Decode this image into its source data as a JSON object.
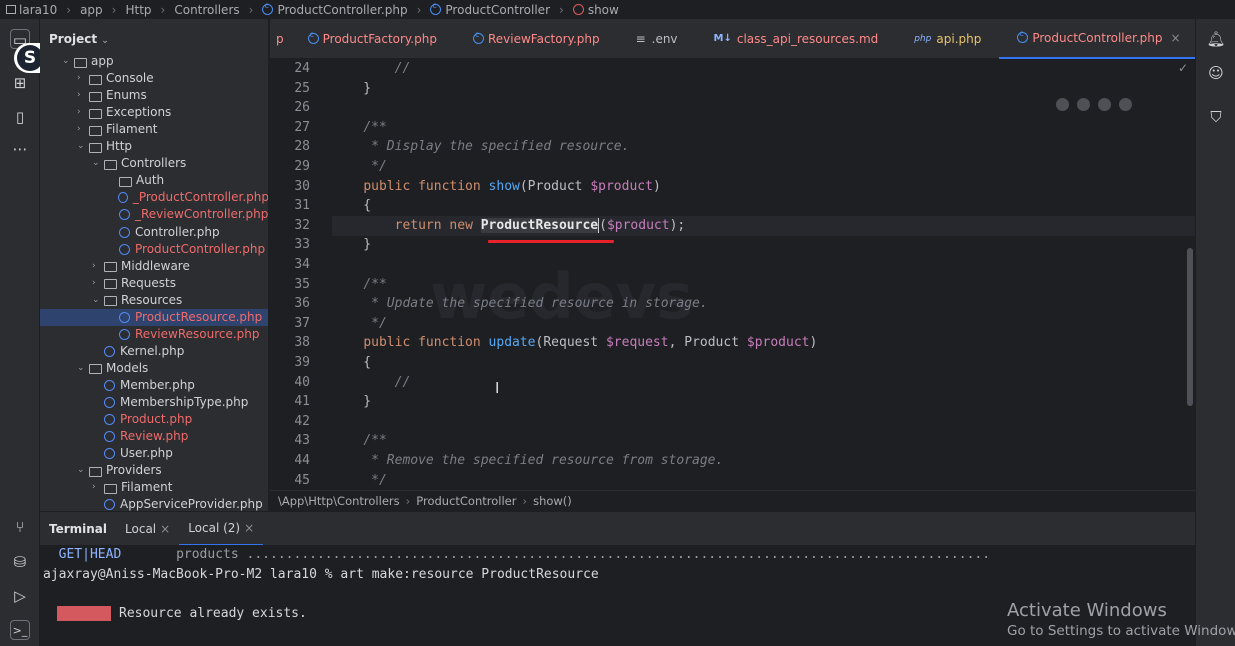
{
  "breadcrumb": {
    "items": [
      "lara10",
      "app",
      "Http",
      "Controllers",
      "ProductController.php",
      "ProductController",
      "show"
    ]
  },
  "project_panel": {
    "title": "Project",
    "rows": [
      {
        "label": "app",
        "type": "folder-open",
        "color": "white"
      },
      {
        "label": "Console",
        "type": "folder",
        "color": "white"
      },
      {
        "label": "Enums",
        "type": "folder",
        "color": "white"
      },
      {
        "label": "Exceptions",
        "type": "folder",
        "color": "white"
      },
      {
        "label": "Filament",
        "type": "folder",
        "color": "white"
      },
      {
        "label": "Http",
        "type": "folder-open",
        "color": "white"
      },
      {
        "label": "Controllers",
        "type": "folder-open",
        "color": "white"
      },
      {
        "label": "Auth",
        "type": "folder-leaf",
        "color": "white"
      },
      {
        "label": "_ProductController.php",
        "type": "php",
        "color": "red"
      },
      {
        "label": "_ReviewController.php",
        "type": "php",
        "color": "red"
      },
      {
        "label": "Controller.php",
        "type": "php",
        "color": "white"
      },
      {
        "label": "ProductController.php",
        "type": "php",
        "color": "red"
      },
      {
        "label": "Middleware",
        "type": "folder",
        "color": "white"
      },
      {
        "label": "Requests",
        "type": "folder",
        "color": "white"
      },
      {
        "label": "Resources",
        "type": "folder-open",
        "color": "white"
      },
      {
        "label": "ProductResource.php",
        "type": "php",
        "color": "red",
        "selected": true
      },
      {
        "label": "ReviewResource.php",
        "type": "php",
        "color": "red"
      },
      {
        "label": "Kernel.php",
        "type": "php",
        "color": "white"
      },
      {
        "label": "Models",
        "type": "folder-open",
        "color": "white"
      },
      {
        "label": "Member.php",
        "type": "php",
        "color": "white"
      },
      {
        "label": "MembershipType.php",
        "type": "php",
        "color": "white"
      },
      {
        "label": "Product.php",
        "type": "php",
        "color": "red"
      },
      {
        "label": "Review.php",
        "type": "php",
        "color": "red"
      },
      {
        "label": "User.php",
        "type": "php",
        "color": "white"
      },
      {
        "label": "Providers",
        "type": "folder-open",
        "color": "white"
      },
      {
        "label": "Filament",
        "type": "folder",
        "color": "white"
      },
      {
        "label": "AppServiceProvider.php",
        "type": "php",
        "color": "white"
      }
    ]
  },
  "tabs": [
    {
      "label": "p",
      "icon": "none",
      "color": "r"
    },
    {
      "label": "ProductFactory.php",
      "icon": "php",
      "color": "r"
    },
    {
      "label": "ReviewFactory.php",
      "icon": "php",
      "color": "r"
    },
    {
      "label": ".env",
      "icon": "env",
      "color": "g"
    },
    {
      "label": "class_api_resources.md",
      "icon": "md",
      "color": "r"
    },
    {
      "label": "api.php",
      "icon": "php-file",
      "color": "y"
    },
    {
      "label": "ProductController.php",
      "icon": "php",
      "color": "r",
      "active": true
    }
  ],
  "editor": {
    "lines": [
      {
        "n": "24",
        "html_parts": [
          [
            "tx",
            "        "
          ],
          [
            "cm",
            "//"
          ]
        ]
      },
      {
        "n": "25",
        "html_parts": [
          [
            "tx",
            "    }"
          ]
        ]
      },
      {
        "n": "26",
        "html_parts": []
      },
      {
        "n": "27",
        "html_parts": [
          [
            "tx",
            "    "
          ],
          [
            "cm",
            "/**"
          ]
        ]
      },
      {
        "n": "28",
        "html_parts": [
          [
            "tx",
            "     "
          ],
          [
            "cm",
            "* Display the specified resource."
          ]
        ]
      },
      {
        "n": "29",
        "html_parts": [
          [
            "tx",
            "     "
          ],
          [
            "cm",
            "*/"
          ]
        ]
      },
      {
        "n": "30",
        "html_parts": [
          [
            "tx",
            "    "
          ],
          [
            "kw",
            "public function "
          ],
          [
            "fn",
            "show"
          ],
          [
            "tx",
            "(Product "
          ],
          [
            "var",
            "$product"
          ],
          [
            "tx",
            ")"
          ]
        ]
      },
      {
        "n": "31",
        "html_parts": [
          [
            "tx",
            "    {"
          ]
        ]
      },
      {
        "n": "32",
        "current": true,
        "html_parts": [
          [
            "tx",
            "        "
          ],
          [
            "kw",
            "return new "
          ],
          [
            "hl",
            "ProductResource"
          ],
          [
            "tx",
            "("
          ],
          [
            "var",
            "$product"
          ],
          [
            "tx",
            ");"
          ]
        ]
      },
      {
        "n": "33",
        "html_parts": [
          [
            "tx",
            "    }"
          ]
        ]
      },
      {
        "n": "34",
        "html_parts": []
      },
      {
        "n": "35",
        "html_parts": [
          [
            "tx",
            "    "
          ],
          [
            "cm",
            "/**"
          ]
        ]
      },
      {
        "n": "36",
        "html_parts": [
          [
            "tx",
            "     "
          ],
          [
            "cm",
            "* Update the specified resource in storage."
          ]
        ]
      },
      {
        "n": "37",
        "html_parts": [
          [
            "tx",
            "     "
          ],
          [
            "cm",
            "*/"
          ]
        ]
      },
      {
        "n": "38",
        "html_parts": [
          [
            "tx",
            "    "
          ],
          [
            "kw",
            "public function "
          ],
          [
            "fn",
            "update"
          ],
          [
            "tx",
            "(Request "
          ],
          [
            "var",
            "$request"
          ],
          [
            "tx",
            ", Product "
          ],
          [
            "var",
            "$product"
          ],
          [
            "tx",
            ")"
          ]
        ]
      },
      {
        "n": "39",
        "html_parts": [
          [
            "tx",
            "    {"
          ]
        ]
      },
      {
        "n": "40",
        "html_parts": [
          [
            "tx",
            "        "
          ],
          [
            "cm",
            "//"
          ]
        ]
      },
      {
        "n": "41",
        "html_parts": [
          [
            "tx",
            "    }"
          ]
        ]
      },
      {
        "n": "42",
        "html_parts": []
      },
      {
        "n": "43",
        "html_parts": [
          [
            "tx",
            "    "
          ],
          [
            "cm",
            "/**"
          ]
        ]
      },
      {
        "n": "44",
        "html_parts": [
          [
            "tx",
            "     "
          ],
          [
            "cm",
            "* Remove the specified resource from storage."
          ]
        ]
      },
      {
        "n": "45",
        "html_parts": [
          [
            "tx",
            "     "
          ],
          [
            "cm",
            "*/"
          ]
        ]
      }
    ]
  },
  "status_crumb": [
    "\\App\\Http\\Controllers",
    "ProductController",
    "show()"
  ],
  "terminal": {
    "title": "Terminal",
    "tabs": [
      "Local",
      "Local (2)"
    ],
    "line1_method": "GET|HEAD",
    "line1_route": "products",
    "line1_dots": "...............................................................................................",
    "prompt": "ajaxray@Aniss-MacBook-Pro-M2 lara10 % art make:resource ProductResource",
    "error_msg": "Resource already exists."
  },
  "watermark": "wedevs",
  "activate": {
    "title": "Activate Windows",
    "subtitle": "Go to Settings to activate Windows."
  },
  "badge": "S"
}
